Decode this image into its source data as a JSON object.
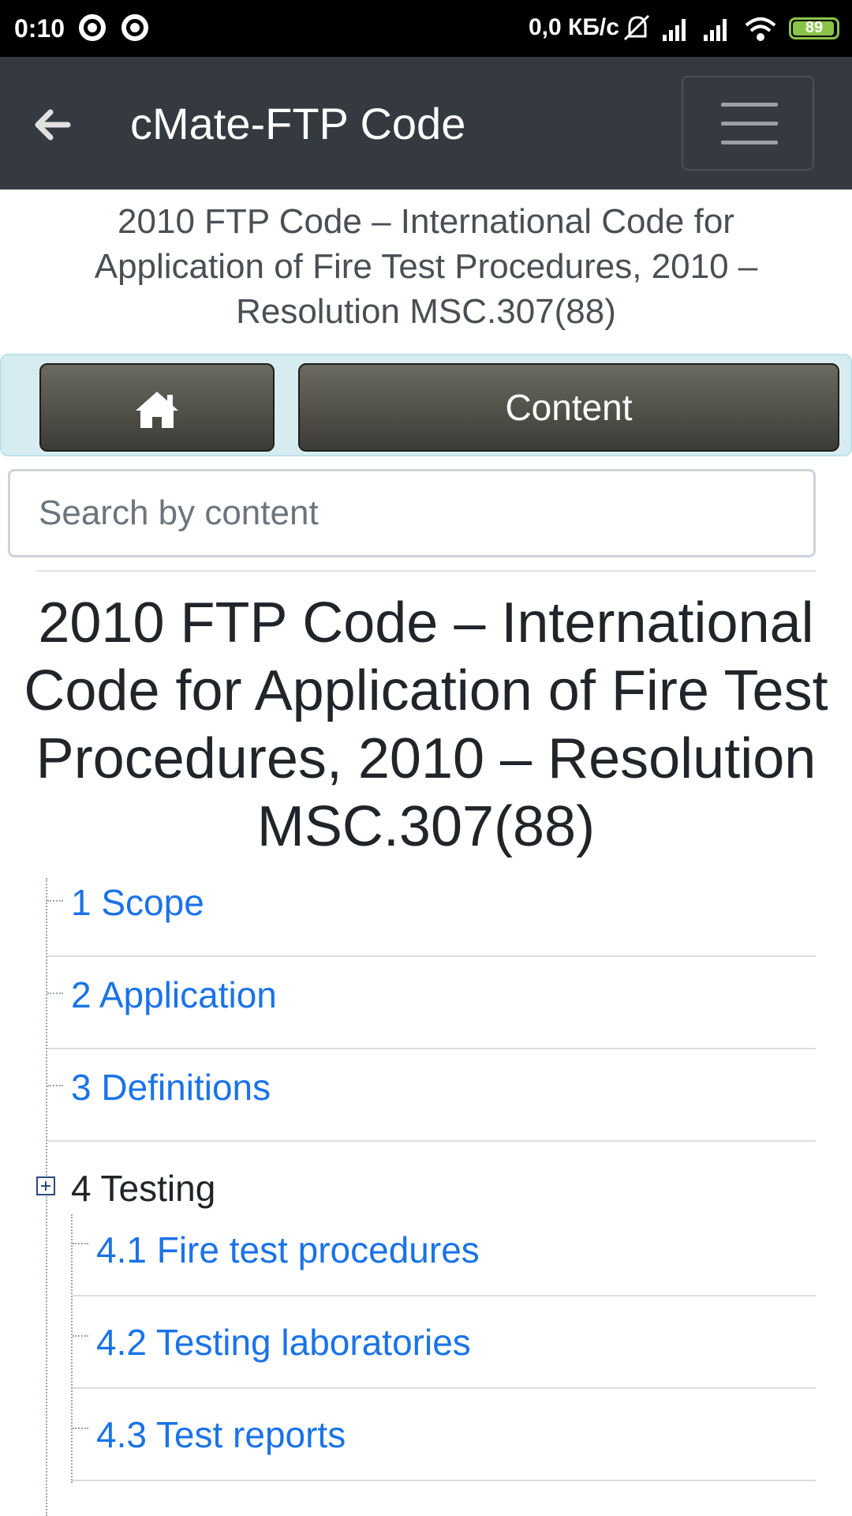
{
  "status_bar": {
    "time": "0:10",
    "network_speed": "0,0 КБ/с",
    "battery": "89"
  },
  "app_bar": {
    "title": "cMate-FTP Code"
  },
  "document": {
    "header_title": "2010 FTP Code – International Code for Application of Fire Test Procedures, 2010 – Resolution MSC.307(88)",
    "main_title": "2010 FTP Code – International Code for Application of Fire Test Procedures, 2010 – Resolution MSC.307(88)"
  },
  "nav": {
    "content_label": "Content"
  },
  "search": {
    "placeholder": "Search by content"
  },
  "toc": {
    "items": [
      {
        "label": "1 Scope"
      },
      {
        "label": "2 Application"
      },
      {
        "label": "3 Definitions"
      }
    ],
    "section4": {
      "label": "4 Testing",
      "children": [
        {
          "label": "4.1 Fire test procedures"
        },
        {
          "label": "4.2 Testing laboratories"
        },
        {
          "label": "4.3 Test reports"
        }
      ]
    }
  },
  "colors": {
    "appbar": "#343a40",
    "link": "#1a73e8",
    "nav_bg": "#d6ecf1"
  }
}
